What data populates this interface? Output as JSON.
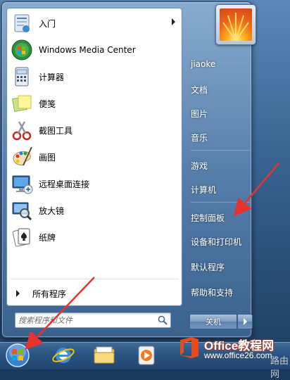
{
  "programs": [
    {
      "label": "入门",
      "icon": "getting-started-icon",
      "has_submenu": true
    },
    {
      "label": "Windows Media Center",
      "icon": "windows-media-center-icon",
      "has_submenu": false
    },
    {
      "label": "计算器",
      "icon": "calculator-icon",
      "has_submenu": false
    },
    {
      "label": "便笺",
      "icon": "sticky-notes-icon",
      "has_submenu": false
    },
    {
      "label": "截图工具",
      "icon": "snipping-tool-icon",
      "has_submenu": false
    },
    {
      "label": "画图",
      "icon": "paint-icon",
      "has_submenu": false
    },
    {
      "label": "远程桌面连接",
      "icon": "remote-desktop-icon",
      "has_submenu": false
    },
    {
      "label": "放大镜",
      "icon": "magnifier-icon",
      "has_submenu": false
    },
    {
      "label": "纸牌",
      "icon": "solitaire-icon",
      "has_submenu": false
    }
  ],
  "all_programs": "所有程序",
  "search": {
    "placeholder": "搜索程序和文件"
  },
  "right_links": [
    "jiaoke",
    "文档",
    "图片",
    "音乐",
    "游戏",
    "计算机",
    "控制面板",
    "设备和打印机",
    "默认程序",
    "帮助和支持"
  ],
  "shutdown": {
    "label": "关机"
  },
  "taskbar": {
    "icons": [
      "start-orb-icon",
      "internet-explorer-icon",
      "windows-explorer-icon",
      "media-player-icon"
    ]
  },
  "watermark": {
    "brand": "Office教程网",
    "url": "www.office26.com",
    "extra": "路由网"
  },
  "colors": {
    "annotation_arrow": "#e8322b",
    "brand_orange": "#e64b1e"
  }
}
